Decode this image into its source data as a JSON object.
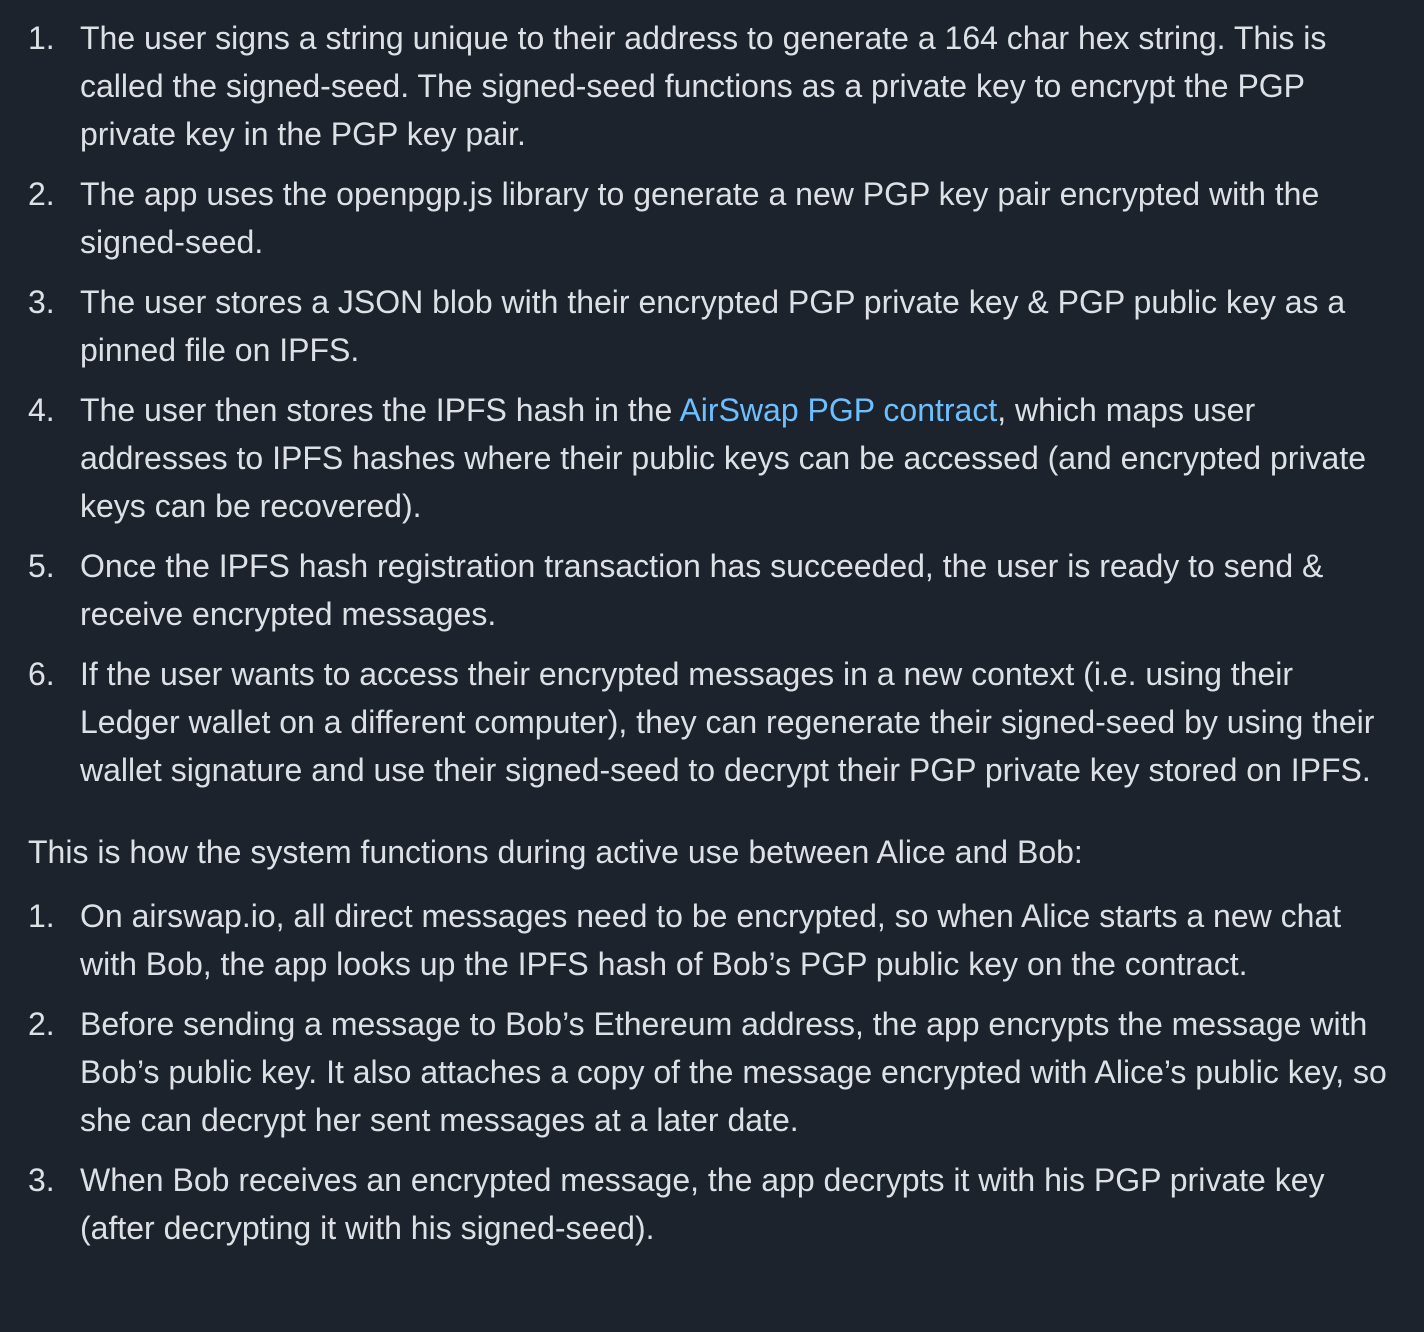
{
  "list1": [
    {
      "num": "1.",
      "text": "The user signs a string unique to their address to generate a 164 char hex string. This is called the signed-seed. The signed-seed functions as a private key to encrypt the PGP private key in the PGP key pair."
    },
    {
      "num": "2.",
      "text": "The app uses the openpgp.js library to generate a new PGP key pair encrypted with the signed-seed."
    },
    {
      "num": "3.",
      "text": "The user stores a JSON blob with their encrypted PGP private key & PGP public key as a pinned file on IPFS."
    },
    {
      "num": "4.",
      "before": "The user then stores the IPFS hash in the ",
      "link": "AirSwap PGP contract",
      "after": ", which maps user addresses to IPFS hashes where their public keys can be accessed (and encrypted private keys can be recovered)."
    },
    {
      "num": "5.",
      "text": "Once the IPFS hash registration transaction has succeeded, the user is ready to send & receive encrypted messages."
    },
    {
      "num": "6.",
      "text": "If the user wants to access their encrypted messages in a new context (i.e. using their Ledger wallet on a different computer), they can regenerate their signed-seed by using their wallet signature and use their signed-seed to decrypt their PGP private key stored on IPFS."
    }
  ],
  "paragraph": "This is how the system functions during active use between Alice and Bob:",
  "list2": [
    {
      "num": "1.",
      "text": "On airswap.io, all direct messages need to be encrypted, so when Alice starts a new chat with Bob, the app looks up the IPFS hash of Bob’s PGP public key on the contract."
    },
    {
      "num": "2.",
      "text": "Before sending a message to Bob’s Ethereum address, the app encrypts the message with Bob’s public key. It also attaches a copy of the message encrypted with Alice’s public key, so she can decrypt her sent messages at a later date."
    },
    {
      "num": "3.",
      "text": "When Bob receives an encrypted message, the app decrypts it with his PGP private key (after decrypting it with his signed-seed)."
    }
  ],
  "colors": {
    "background": "#1c232c",
    "text": "#dde1e6",
    "link": "#6cc0ff"
  }
}
